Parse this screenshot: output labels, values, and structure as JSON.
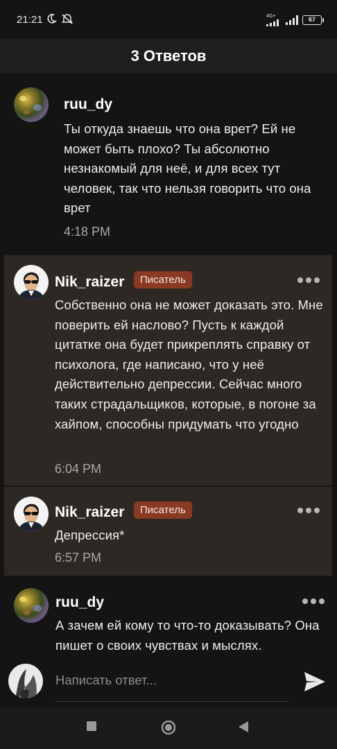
{
  "status_bar": {
    "time": "21:21",
    "battery": "67",
    "network": "4G+"
  },
  "header": {
    "title": "3 Ответов"
  },
  "comments": [
    {
      "author": "ruu_dy",
      "badge": "",
      "text": "Ты откуда знаешь что она врет? Ей не может быть плохо? Ты абсолютно незнакомый для неё, и для всех тут человек, так что нельзя говорить что она врет",
      "time": "4:18 PM",
      "avatar_icon": "avatar-ruu"
    },
    {
      "author": "Nik_raizer",
      "badge": "Писатель",
      "text": "Собственно она не может доказать это. Мне поверить ей наслово? Пусть к каждой цитатке она будет прикреплять справку от психолога, где написано, что у неё действительно депрессии. Сейчас много таких страдальщиков, которые, в погоне за хайпом, способны придумать что угодно",
      "time": "6:04 PM",
      "avatar_icon": "avatar-nik"
    },
    {
      "author": "Nik_raizer",
      "badge": "Писатель",
      "text": "Депрессия*",
      "time": "6:57 PM",
      "avatar_icon": "avatar-nik"
    },
    {
      "author": "ruu_dy",
      "badge": "",
      "text": "А зачем ей кому то что-то доказывать? Она пишет о своих чувствах и мыслях.",
      "time": "",
      "avatar_icon": "avatar-ruu"
    }
  ],
  "composer": {
    "placeholder": "Написать ответ..."
  },
  "colors": {
    "background": "#141414",
    "highlight": "#2e2824",
    "badge": "#8a3a22"
  }
}
